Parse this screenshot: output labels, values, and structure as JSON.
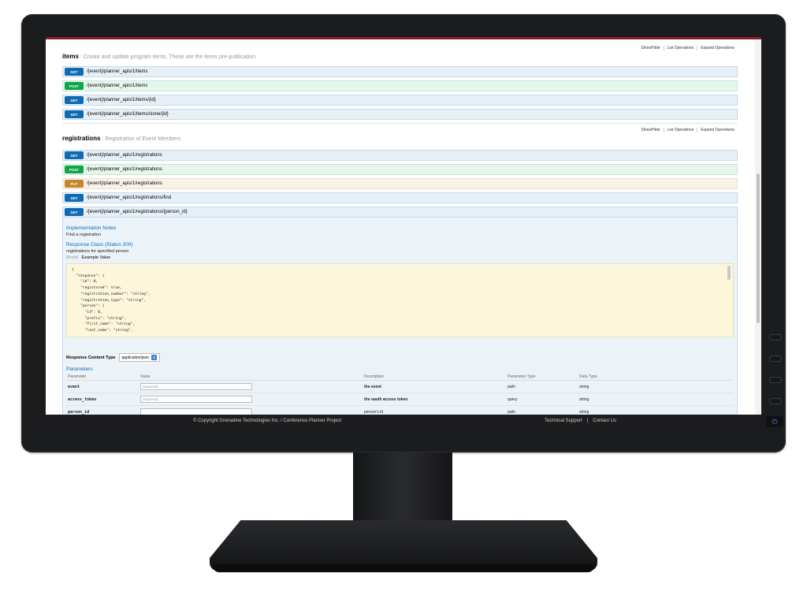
{
  "resources": [
    {
      "name": "items",
      "description": ": Create and update program items. These are the items pre-publication.",
      "ops": [
        "Show/Hide",
        "List Operations",
        "Expand Operations"
      ],
      "endpoints": [
        {
          "method": "GET",
          "path": "/{event}/planner_apis/1/items"
        },
        {
          "method": "POST",
          "path": "/{event}/planner_apis/1/items"
        },
        {
          "method": "GET",
          "path": "/{event}/planner_apis/1/items/{id}"
        },
        {
          "method": "GET",
          "path": "/{event}/planner_apis/1/items/clone/{id}"
        }
      ]
    },
    {
      "name": "registrations",
      "description": ": Registration of Event Members",
      "ops": [
        "Show/Hide",
        "List Operations",
        "Expand Operations"
      ],
      "endpoints": [
        {
          "method": "GET",
          "path": "/{event}/planner_apis/1/registrations"
        },
        {
          "method": "POST",
          "path": "/{event}/planner_apis/1/registrations"
        },
        {
          "method": "PUT",
          "path": "/{event}/planner_apis/1/registrations"
        },
        {
          "method": "GET",
          "path": "/{event}/planner_apis/1/registrations/find"
        },
        {
          "method": "GET",
          "path": "/{event}/planner_apis/1/registrations/{person_id}"
        }
      ]
    }
  ],
  "expanded": {
    "impl_notes_title": "Implementation Notes",
    "impl_notes": "Find a registration",
    "response_class_title": "Response Class (Status 200)",
    "response_class_text": "registrations for specified person",
    "model_label": "Model",
    "example_label": "Example Value",
    "example_code": "{\n  \"response\": {\n    \"id\": 0,\n    \"registered\": true,\n    \"registration_number\": \"string\",\n    \"registration_type\": \"string\",\n    \"person\": {\n      \"id\": 0,\n      \"prefix\": \"string\",\n      \"first_name\": \"string\",\n      \"last_name\": \"string\",",
    "content_type_label": "Response Content Type",
    "content_type_value": "application/json",
    "parameters_title": "Parameters",
    "param_headers": [
      "Parameter",
      "Value",
      "Description",
      "Parameter Type",
      "Data Type"
    ],
    "params": [
      {
        "name": "event",
        "placeholder": "(required)",
        "description": "the event",
        "ptype": "path",
        "dtype": "string"
      },
      {
        "name": "access_token",
        "placeholder": "(required)",
        "description": "the oauth access token",
        "ptype": "query",
        "dtype": "string"
      },
      {
        "name": "person_id",
        "placeholder": "",
        "description": "person's id",
        "ptype": "path",
        "dtype": "string"
      }
    ]
  },
  "footer": {
    "copyright": "© Copyright Grenadine Technologies Inc. / Conference Planner Project",
    "links": [
      "Technical Support",
      "Contact Us"
    ],
    "separator": "|"
  },
  "icons": {
    "power": "power-icon",
    "select_arrow": "chevron-updown-icon"
  },
  "colors": {
    "get": "#0f6ab4",
    "post": "#10a54a",
    "put": "#c5862b",
    "accent_bar": "#8b1d2c"
  }
}
